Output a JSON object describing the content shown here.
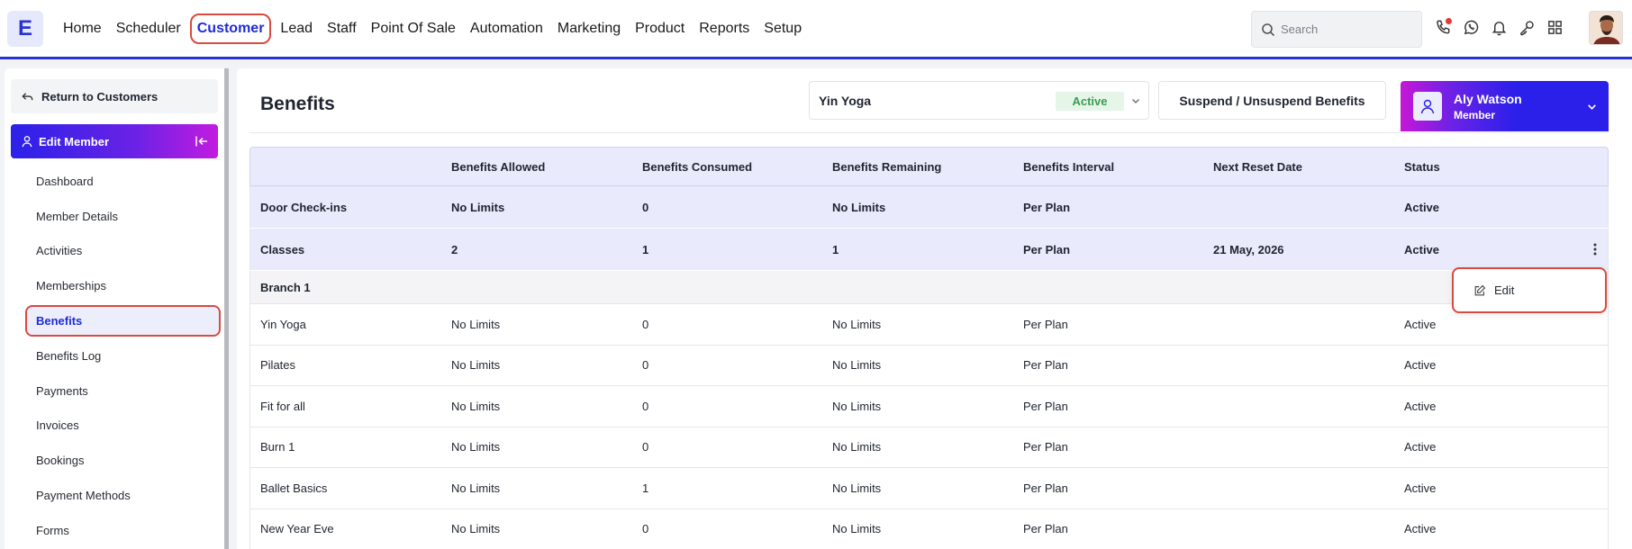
{
  "app": {
    "logo_letter": "E"
  },
  "nav": {
    "items": [
      {
        "label": "Home",
        "active": false
      },
      {
        "label": "Scheduler",
        "active": false
      },
      {
        "label": "Customer",
        "active": true
      },
      {
        "label": "Lead",
        "active": false
      },
      {
        "label": "Staff",
        "active": false
      },
      {
        "label": "Point Of Sale",
        "active": false
      },
      {
        "label": "Automation",
        "active": false
      },
      {
        "label": "Marketing",
        "active": false
      },
      {
        "label": "Product",
        "active": false
      },
      {
        "label": "Reports",
        "active": false
      },
      {
        "label": "Setup",
        "active": false
      }
    ],
    "search_placeholder": "Search",
    "icons": [
      "phone-icon",
      "whatsapp-icon",
      "bell-icon",
      "key-icon",
      "apps-grid-icon"
    ]
  },
  "sidebar": {
    "return_label": "Return to Customers",
    "section_label": "Edit Member",
    "items": [
      {
        "label": "Dashboard",
        "active": false
      },
      {
        "label": "Member Details",
        "active": false
      },
      {
        "label": "Activities",
        "active": false
      },
      {
        "label": "Memberships",
        "active": false
      },
      {
        "label": "Benefits",
        "active": true
      },
      {
        "label": "Benefits Log",
        "active": false
      },
      {
        "label": "Payments",
        "active": false
      },
      {
        "label": "Invoices",
        "active": false
      },
      {
        "label": "Bookings",
        "active": false
      },
      {
        "label": "Payment Methods",
        "active": false
      },
      {
        "label": "Forms",
        "active": false
      }
    ]
  },
  "main": {
    "title": "Benefits",
    "plan": {
      "name": "Yin Yoga",
      "status": "Active"
    },
    "suspend_label": "Suspend / Unsuspend Benefits",
    "member": {
      "name": "Aly Watson",
      "role": "Member"
    },
    "table": {
      "columns": [
        "",
        "Benefits Allowed",
        "Benefits Consumed",
        "Benefits Remaining",
        "Benefits Interval",
        "Next Reset Date",
        "Status"
      ],
      "rows": [
        {
          "type": "group",
          "cells": [
            "Door Check-ins",
            "No Limits",
            "0",
            "No Limits",
            "Per Plan",
            "",
            "Active"
          ],
          "menu": false
        },
        {
          "type": "group",
          "cells": [
            "Classes",
            "2",
            "1",
            "1",
            "Per Plan",
            "21 May, 2026",
            "Active"
          ],
          "menu": true
        },
        {
          "type": "branch",
          "cells": [
            "Branch 1",
            "",
            "",
            "",
            "",
            "",
            ""
          ],
          "menu": false
        },
        {
          "type": "item",
          "cells": [
            "Yin Yoga",
            "No Limits",
            "0",
            "No Limits",
            "Per Plan",
            "",
            "Active"
          ],
          "menu": false
        },
        {
          "type": "item",
          "cells": [
            "Pilates",
            "No Limits",
            "0",
            "No Limits",
            "Per Plan",
            "",
            "Active"
          ],
          "menu": false
        },
        {
          "type": "item",
          "cells": [
            "Fit for all",
            "No Limits",
            "0",
            "No Limits",
            "Per Plan",
            "",
            "Active"
          ],
          "menu": false
        },
        {
          "type": "item",
          "cells": [
            "Burn 1",
            "No Limits",
            "0",
            "No Limits",
            "Per Plan",
            "",
            "Active"
          ],
          "menu": false
        },
        {
          "type": "item",
          "cells": [
            "Ballet Basics",
            "No Limits",
            "1",
            "No Limits",
            "Per Plan",
            "",
            "Active"
          ],
          "menu": false
        },
        {
          "type": "item",
          "cells": [
            "New Year Eve",
            "No Limits",
            "0",
            "No Limits",
            "Per Plan",
            "",
            "Active"
          ],
          "menu": false
        }
      ]
    },
    "row_menu": {
      "edit_label": "Edit"
    }
  },
  "colors": {
    "accent": "#2a32d6",
    "highlight": "#d94a3f",
    "active_green": "#3a9b50"
  }
}
